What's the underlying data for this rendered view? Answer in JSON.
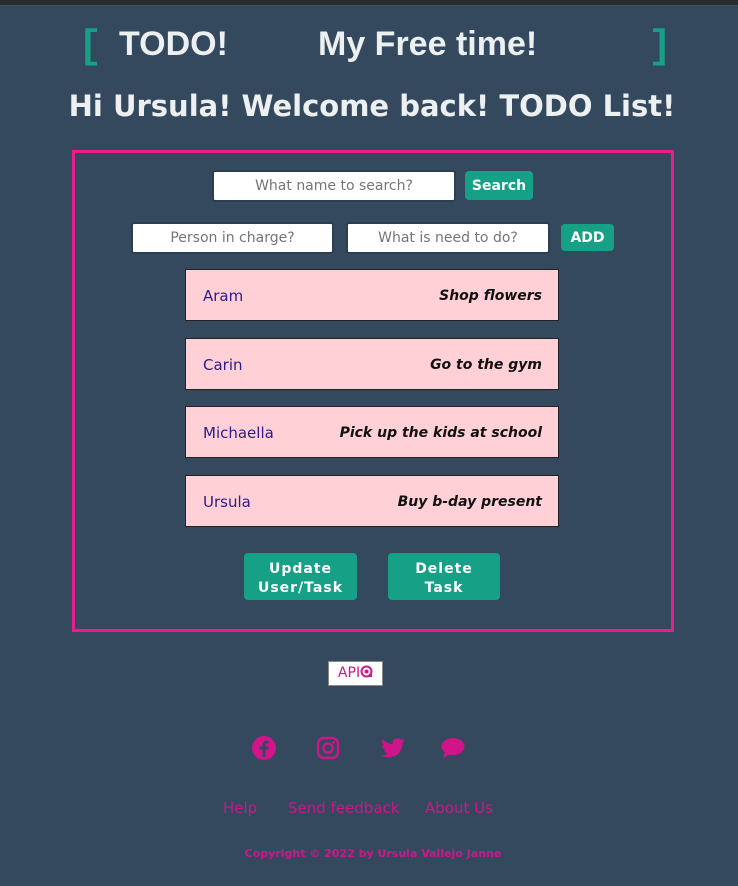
{
  "header": {
    "logo_left": "TODO!",
    "logo_right": "My Free time!",
    "bracket_open": "[",
    "bracket_close": "]",
    "greeting": "Hi Ursula! Welcome back! TODO List!"
  },
  "search": {
    "placeholder": "What name to search?",
    "button_label": "Search"
  },
  "add_form": {
    "person_placeholder": "Person in charge?",
    "task_placeholder": "What is need to do?",
    "button_label": "ADD"
  },
  "tasks": [
    {
      "person": "Aram",
      "task": "Shop flowers"
    },
    {
      "person": "Carin",
      "task": "Go to the gym"
    },
    {
      "person": "Michaella",
      "task": "Pick up the kids at school"
    },
    {
      "person": "Ursula",
      "task": "Buy b-day present"
    }
  ],
  "actions": {
    "update_line1": "Update",
    "update_line2": "User/Task",
    "delete_line1": "Delete",
    "delete_line2": "Task"
  },
  "api_link": {
    "label": "API",
    "icon": "api-settings-icon"
  },
  "social": [
    "facebook-icon",
    "instagram-icon",
    "twitter-icon",
    "chat-icon"
  ],
  "footer": {
    "links": [
      "Help",
      "Send feedback",
      "About Us"
    ],
    "copyright": "Copyright © 2022 by Ursula Vallejo Janne"
  },
  "colors": {
    "background": "#34495e",
    "accent": "#16a085",
    "panel_border": "#e91e8c",
    "task_bg": "#ffd1d6",
    "link": "#d0148a"
  }
}
